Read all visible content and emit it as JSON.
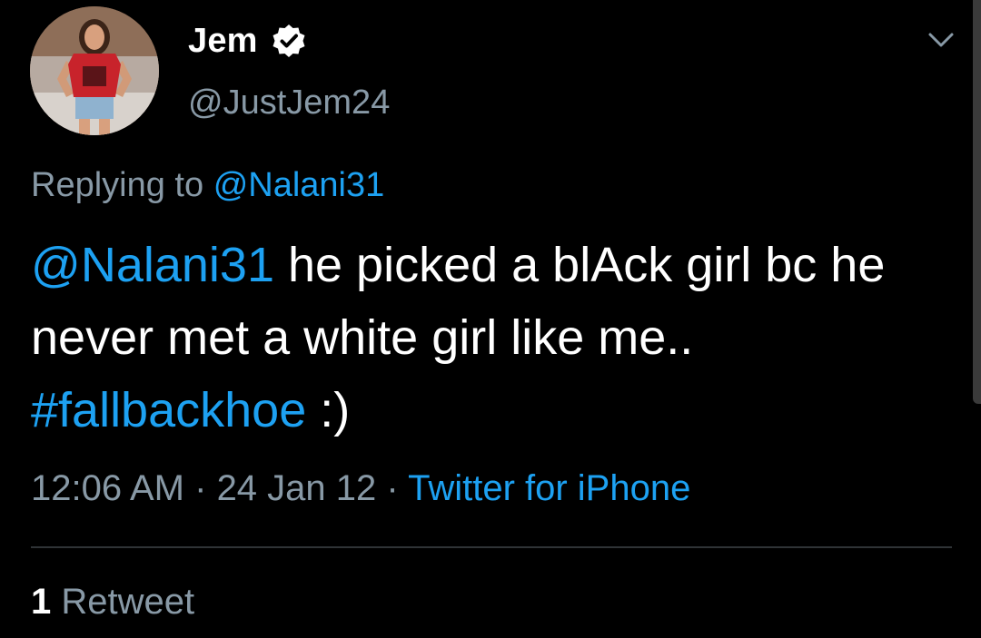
{
  "tweet": {
    "author": {
      "name": "Jem",
      "handle": "@JustJem24",
      "verified": true
    },
    "replying_prefix": "Replying to",
    "replying_handle": "@Nalani31",
    "text": {
      "mention": "@Nalani31",
      "part1": " he picked a blAck girl bc he never met a white girl like me.. ",
      "hashtag": "#fallbackhoe",
      "part2": " :)"
    },
    "time": "12:06 AM",
    "separator": " · ",
    "date": "24 Jan 12",
    "source": "Twitter for iPhone",
    "retweet_count": "1",
    "retweet_label": " Retweet"
  },
  "icons": {
    "verified": "verified-badge-icon",
    "menu": "chevron-down-icon"
  },
  "colors": {
    "background": "#000000",
    "link": "#1da1f2",
    "secondary": "#8899a6",
    "primary": "#ffffff"
  }
}
